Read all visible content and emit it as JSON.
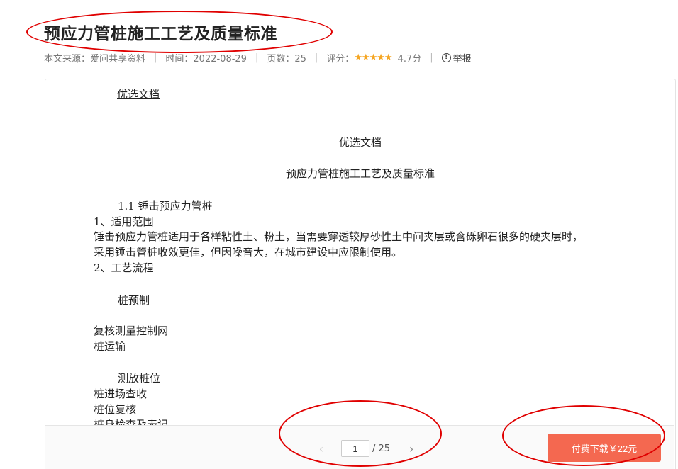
{
  "document": {
    "title": "预应力管桩施工工艺及质量标准",
    "meta": {
      "source": "本文来源：爱问共享资料",
      "time": "时间：2022-08-29",
      "pages": "页数：25",
      "rating_label": "评分：",
      "stars": "★★★★★",
      "rating_value": "4.7分",
      "report": "举报"
    }
  },
  "preview": {
    "header": "优选文档",
    "heading": "优选文档",
    "doc_title": "预应力管桩施工工艺及质量标准",
    "lines": [
      "1.1 锤击预应力管桩",
      "1、适用范围",
      "锤击预应力管桩适用于各样粘性土、粉土，当需要穿透较厚砂性土中间夹层或含砾卵石很多的硬夹层时，",
      "采用锤击管桩收效更佳，但因噪音大，在城市建设中应限制使用。",
      "2、工艺流程",
      "桩预制",
      "复核测量控制网",
      "桩运输",
      "测放桩位",
      "桩进场查收",
      "桩位复核",
      "桩身检查及表记"
    ]
  },
  "pager": {
    "prev": "‹",
    "current_page": "1",
    "total": "/ 25",
    "next": "›"
  },
  "download": {
    "label": "付费下载￥22元"
  },
  "colors": {
    "accent": "#f46850",
    "star": "#f5a623",
    "annotation": "#e00000"
  }
}
